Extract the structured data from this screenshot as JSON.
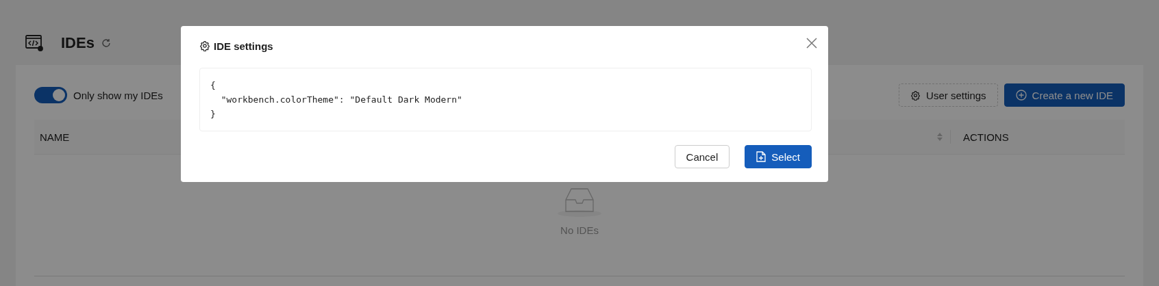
{
  "page": {
    "title": "IDEs"
  },
  "toolbar": {
    "toggle": {
      "label": "Only show my IDEs",
      "on": true
    },
    "buttons": [
      {
        "label": "User settings",
        "kind": "secondary"
      },
      {
        "label": "Create a new IDE",
        "kind": "primary"
      }
    ]
  },
  "table": {
    "columns": [
      {
        "label": "NAME"
      },
      {
        "label": "ACTIONS"
      }
    ],
    "empty_text": "No IDEs"
  },
  "dialog": {
    "title": "IDE settings",
    "code": [
      "{",
      "  \"workbench.colorTheme\": \"Default Dark Modern\"",
      "}"
    ],
    "buttons": [
      {
        "label": "Cancel",
        "kind": "secondary"
      },
      {
        "label": "Select",
        "kind": "primary"
      }
    ]
  }
}
